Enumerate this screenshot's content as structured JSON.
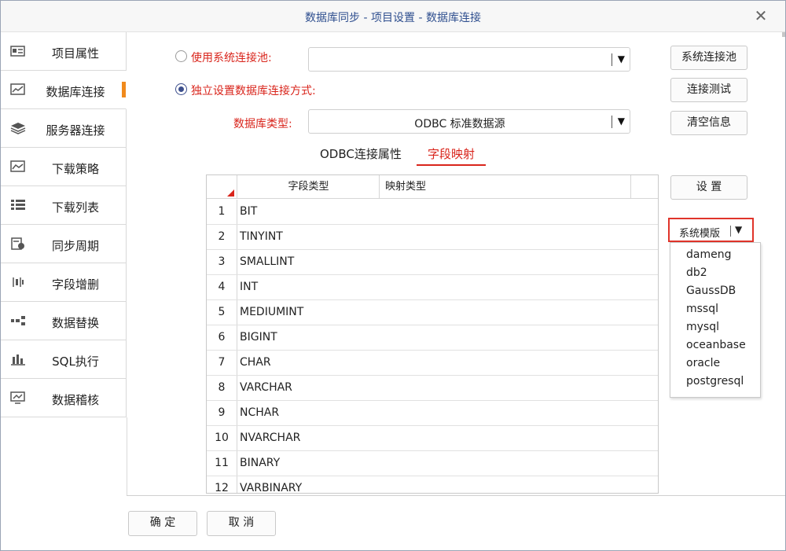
{
  "window": {
    "title": "数据库同步 - 项目设置 - 数据库连接",
    "close_glyph": "✕"
  },
  "sidebar": {
    "active_index": 1,
    "accent_color": "#f08a1c",
    "items": [
      {
        "label": "项目属性",
        "icon": "properties-icon"
      },
      {
        "label": "数据库连接",
        "icon": "connection-chart-icon"
      },
      {
        "label": "服务器连接",
        "icon": "layers-icon"
      },
      {
        "label": "下载策略",
        "icon": "strategy-chart-icon"
      },
      {
        "label": "下载列表",
        "icon": "list-icon"
      },
      {
        "label": "同步周期",
        "icon": "schedule-icon"
      },
      {
        "label": "字段增删",
        "icon": "field-edit-icon"
      },
      {
        "label": "数据替换",
        "icon": "replace-icon"
      },
      {
        "label": "SQL执行",
        "icon": "bar-chart-icon"
      },
      {
        "label": "数据稽核",
        "icon": "audit-icon"
      }
    ]
  },
  "connection": {
    "use_pool_label": "使用系统连接池:",
    "pool_value": "",
    "independent_label": "独立设置数据库连接方式:",
    "db_type_label": "数据库类型:",
    "db_type_value": "ODBC 标准数据源",
    "mode": "independent"
  },
  "buttons": {
    "system_pool": "系统连接池",
    "test_connection": "连接测试",
    "clear_info": "清空信息",
    "settings": "设  置",
    "ok": "确 定",
    "cancel": "取 消"
  },
  "tabs": [
    {
      "label": "ODBC连接属性",
      "active": false
    },
    {
      "label": "字段映射",
      "active": true
    }
  ],
  "grid": {
    "columns": [
      "字段类型",
      "映射类型"
    ],
    "rows": [
      {
        "num": "1",
        "type": "BIT",
        "mapping": ""
      },
      {
        "num": "2",
        "type": "TINYINT",
        "mapping": ""
      },
      {
        "num": "3",
        "type": "SMALLINT",
        "mapping": ""
      },
      {
        "num": "4",
        "type": "INT",
        "mapping": ""
      },
      {
        "num": "5",
        "type": "MEDIUMINT",
        "mapping": ""
      },
      {
        "num": "6",
        "type": "BIGINT",
        "mapping": ""
      },
      {
        "num": "7",
        "type": "CHAR",
        "mapping": ""
      },
      {
        "num": "8",
        "type": "VARCHAR",
        "mapping": ""
      },
      {
        "num": "9",
        "type": "NCHAR",
        "mapping": ""
      },
      {
        "num": "10",
        "type": "NVARCHAR",
        "mapping": ""
      },
      {
        "num": "11",
        "type": "BINARY",
        "mapping": ""
      },
      {
        "num": "12",
        "type": "VARBINARY",
        "mapping": ""
      }
    ]
  },
  "template_select": {
    "label": "系统模版",
    "options": [
      "dameng",
      "db2",
      "GaussDB",
      "mssql",
      "mysql",
      "oceanbase",
      "oracle",
      "postgresql"
    ]
  },
  "colors": {
    "label_red": "#d9251c",
    "radio_blue": "#3c4e8c",
    "title_blue": "#2f4f8f"
  }
}
